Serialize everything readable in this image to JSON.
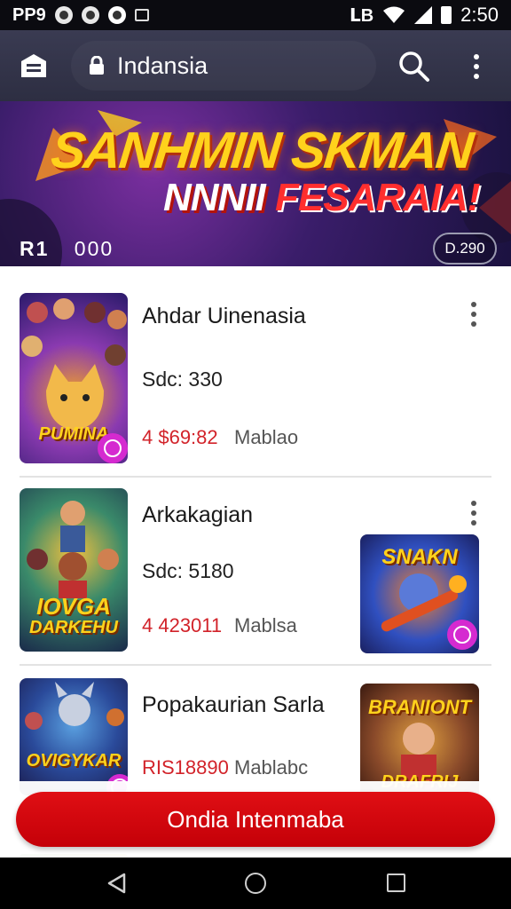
{
  "status_bar": {
    "carrier": "PP9",
    "time": "2:50",
    "signal_label": "ⅬB"
  },
  "app_bar": {
    "site_title": "Indansia",
    "icons": [
      "menu-icon",
      "lock-icon",
      "search-icon",
      "more-vert-icon"
    ]
  },
  "banner": {
    "title": "SANHMIN SKMAN",
    "subtitle_a": "NNNII",
    "subtitle_b": "FESARAIA!",
    "left_a": "R1",
    "left_b": "000",
    "badge": "D.290"
  },
  "items": [
    {
      "title": "Ahdar Uinenasia",
      "sub": "Sdc: 330",
      "price": "4 $69:82",
      "tag": "Mablao",
      "thumb_text": "PUMINA"
    },
    {
      "title": "Arkakagian",
      "sub": "Sdc: 5180",
      "price": "4 423011",
      "tag": "Mablsa",
      "thumb_text_a": "IOVGA",
      "thumb_text_b": "DARKEHU",
      "side_thumb_text": "SNAKN"
    },
    {
      "title": "Popakaurian Sarla",
      "sub": "",
      "price": "RIS18890",
      "tag": "Mablabc",
      "thumb_text": "OVIGYKAR",
      "side_thumb_text": "BRANIONT",
      "side_thumb_text_b": "DRAFRIJ"
    }
  ],
  "cta": {
    "label": "Ondia Intenmaba"
  },
  "colors": {
    "accent_red": "#d2232a",
    "cta_red": "#d4060c",
    "app_bar": "#34354b",
    "badge_pink": "#d52ad0"
  }
}
